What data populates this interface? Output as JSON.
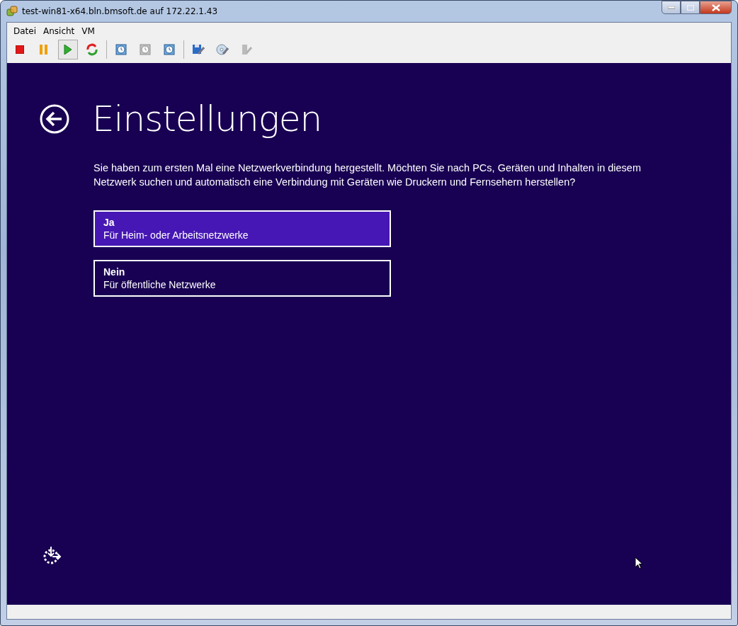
{
  "window": {
    "title": "test-win81-x64.bln.bmsoft.de auf 172.22.1.43"
  },
  "menu": [
    "Datei",
    "Ansicht",
    "VM"
  ],
  "toolbar": [
    {
      "kind": "stop",
      "disabled": false,
      "pressed": false
    },
    {
      "kind": "pause",
      "disabled": false,
      "pressed": false
    },
    {
      "kind": "play",
      "disabled": false,
      "pressed": true
    },
    {
      "kind": "reset",
      "disabled": false,
      "pressed": false
    },
    {
      "kind": "separator"
    },
    {
      "kind": "snapshot",
      "disabled": false,
      "pressed": false
    },
    {
      "kind": "revert",
      "disabled": true,
      "pressed": false
    },
    {
      "kind": "snapshots",
      "disabled": false,
      "pressed": false
    },
    {
      "kind": "separator"
    },
    {
      "kind": "floppy",
      "disabled": false,
      "pressed": false
    },
    {
      "kind": "disc",
      "disabled": false,
      "pressed": false
    },
    {
      "kind": "usb",
      "disabled": true,
      "pressed": false
    }
  ],
  "screen": {
    "heading": "Einstellungen",
    "description": "Sie haben zum ersten Mal eine Netzwerkverbindung hergestellt. Möchten Sie nach PCs, Geräten und Inhalten in diesem Netzwerk suchen und automatisch eine Verbindung mit Geräten wie Druckern und Fernsehern herstellen?",
    "options": [
      {
        "title": "Ja",
        "subtitle": "Für Heim- oder Arbeitsnetzwerke",
        "selected": true
      },
      {
        "title": "Nein",
        "subtitle": "Für öffentliche Netzwerke",
        "selected": false
      }
    ]
  }
}
